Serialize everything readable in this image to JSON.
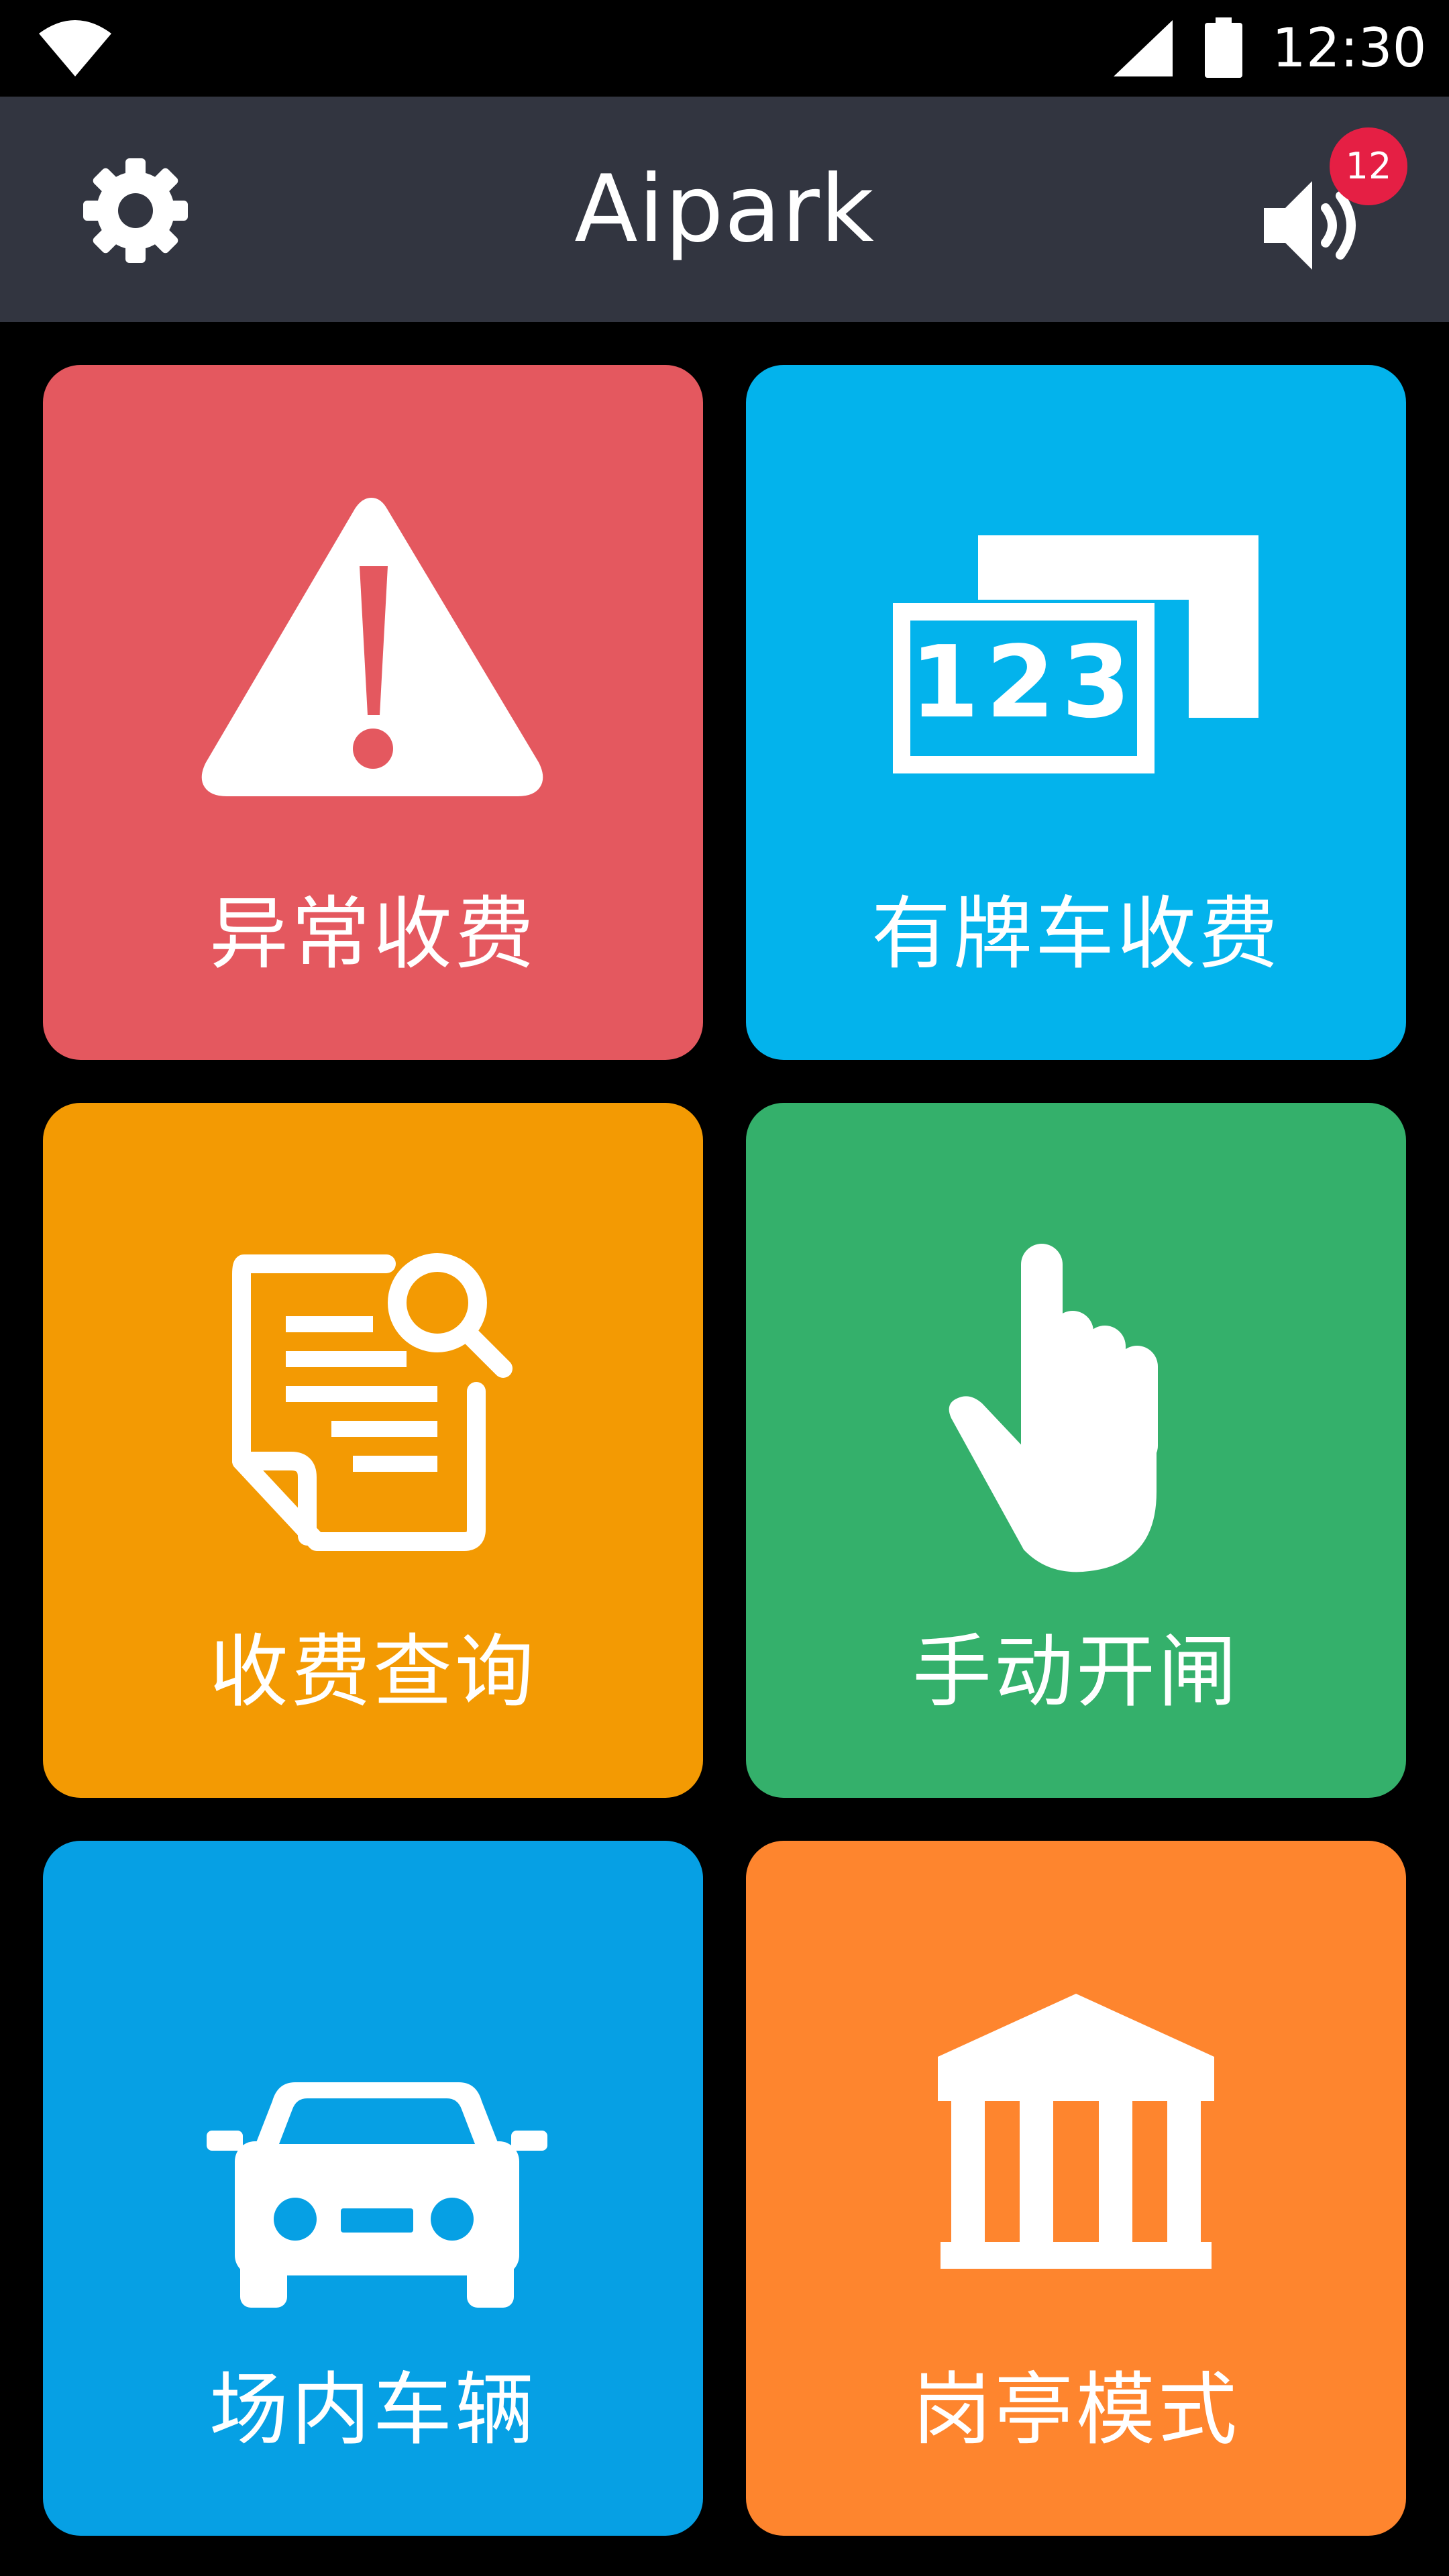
{
  "status_bar": {
    "time": "12:30",
    "icons": [
      "wifi-icon",
      "cell-signal-icon",
      "battery-icon"
    ]
  },
  "app_bar": {
    "title": "Aipark",
    "settings_icon": "gear-icon",
    "sound_icon": "volume-icon",
    "notification_count": "12"
  },
  "tiles": [
    {
      "label": "异常收费",
      "icon": "warning-icon",
      "color": "#e4585f"
    },
    {
      "label": "有牌车收费",
      "icon": "license-plate-icon",
      "color": "#03b3ec"
    },
    {
      "label": "收费查询",
      "icon": "document-search-icon",
      "color": "#f39a03"
    },
    {
      "label": "手动开闸",
      "icon": "pointing-hand-icon",
      "color": "#34b06b"
    },
    {
      "label": "场内车辆",
      "icon": "car-icon",
      "color": "#06a0e4"
    },
    {
      "label": "岗亭模式",
      "icon": "building-icon",
      "color": "#fe852e"
    }
  ],
  "plate_icon_text": "123",
  "colors": {
    "status_bar_bg": "#000000",
    "app_bar_bg": "#323540",
    "page_bg": "#000000",
    "badge": "#e51f44"
  }
}
